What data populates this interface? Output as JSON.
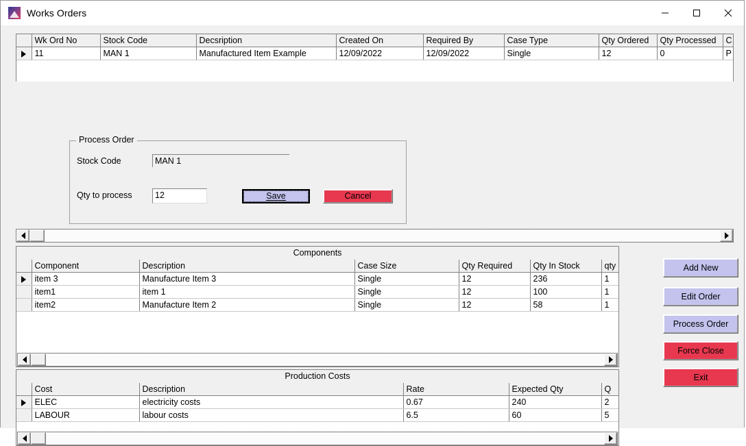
{
  "window": {
    "title": "Works Orders",
    "icon": "app-logo-icon",
    "minimize_label": "minimize-icon",
    "maximize_label": "maximize-icon",
    "close_label": "close-icon"
  },
  "colors": {
    "accent_lavender": "#c3c3ee",
    "accent_red": "#e8384f",
    "window_bg": "#f0f0f0",
    "grid_bg": "#ffffff",
    "border": "#828282"
  },
  "orders_grid": {
    "columns": [
      "Wk Ord No",
      "Stock Code",
      "Decsription",
      "Created On",
      "Required By",
      "Case Type",
      "Qty Ordered",
      "Qty Processed",
      "C"
    ],
    "rows": [
      {
        "selected": true,
        "cells": [
          "11",
          "MAN 1",
          "Manufactured Item Example",
          "12/09/2022",
          "12/09/2022",
          "Single",
          "12",
          "0",
          "P"
        ]
      }
    ]
  },
  "process_order": {
    "legend": "Process Order",
    "stock_code_label": "Stock Code",
    "stock_code_value": "MAN 1",
    "qty_label": "Qty to process",
    "qty_value": "12",
    "qty_placeholder": "",
    "save_label": "Save",
    "cancel_label": "Cancel"
  },
  "components": {
    "title": "Components",
    "columns": [
      "Component",
      "Description",
      "Case Size",
      "Qty Required",
      "Qty In Stock",
      "qty p"
    ],
    "rows": [
      {
        "selected": true,
        "cells": [
          "item 3",
          "Manufacture Item 3",
          "Single",
          "12",
          "236",
          "1"
        ]
      },
      {
        "selected": false,
        "cells": [
          "item1",
          "item 1",
          "Single",
          "12",
          "100",
          "1"
        ]
      },
      {
        "selected": false,
        "cells": [
          "item2",
          "Manufacture Item 2",
          "Single",
          "12",
          "58",
          "1"
        ]
      }
    ]
  },
  "production_costs": {
    "title": "Production Costs",
    "columns": [
      "Cost",
      "Description",
      "Rate",
      "Expected Qty",
      "Q"
    ],
    "rows": [
      {
        "selected": true,
        "cells": [
          "ELEC",
          "electricity costs",
          "0.67",
          "240",
          "2"
        ]
      },
      {
        "selected": false,
        "cells": [
          "LABOUR",
          "labour costs",
          "6.5",
          "60",
          "5"
        ]
      }
    ]
  },
  "side_buttons": [
    {
      "label": "Add New",
      "style": "lavender"
    },
    {
      "label": "Edit Order",
      "style": "lavender"
    },
    {
      "label": "Process Order",
      "style": "lavender"
    },
    {
      "label": "Force Close",
      "style": "red"
    },
    {
      "label": "Exit",
      "style": "red"
    }
  ],
  "scrollbars": {
    "left_arrow": "scroll-left-icon",
    "right_arrow": "scroll-right-icon"
  }
}
